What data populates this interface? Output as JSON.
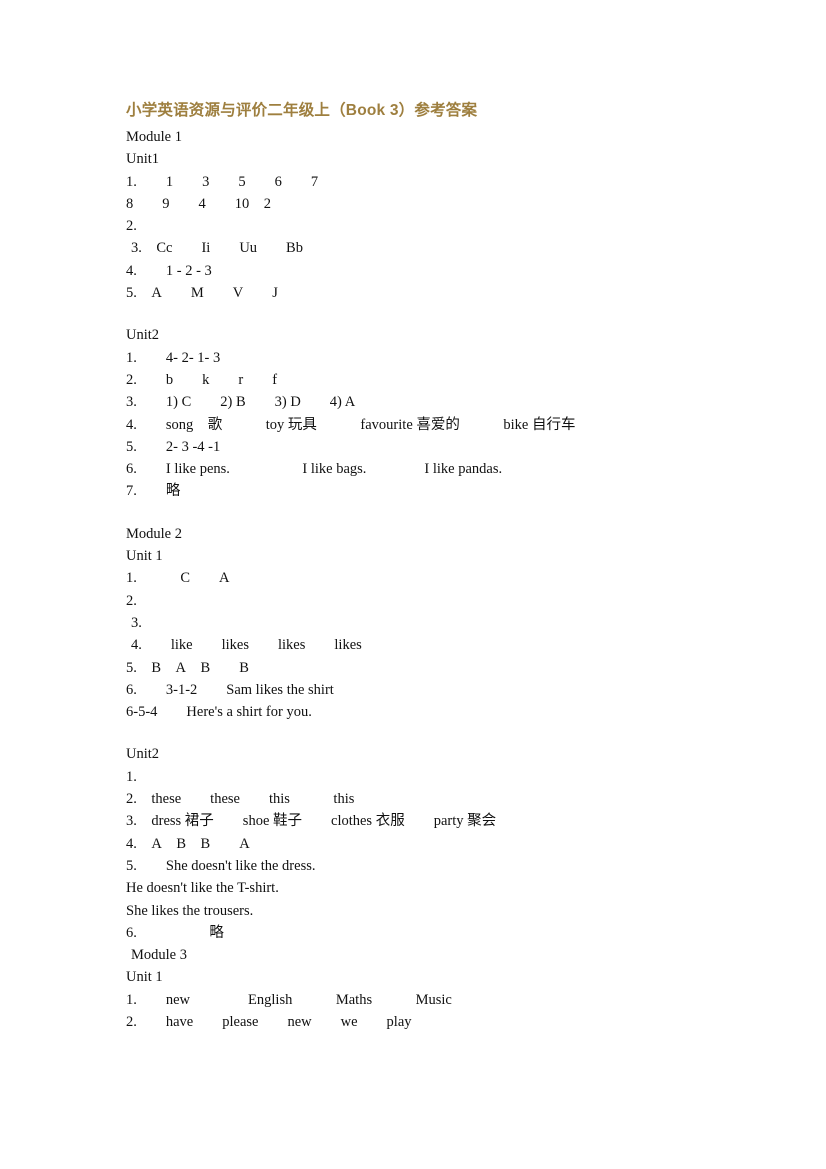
{
  "document": {
    "title": "小学英语资源与评价二年级上（Book 3）参考答案",
    "title_color": "#9e7f3f",
    "page_background": "#ffffff",
    "body_text_color": "#111111"
  },
  "blocks": [
    {
      "kind": "module-heading",
      "text": "Module 1",
      "indent": 0
    },
    {
      "kind": "unit-heading",
      "text": "Unit1",
      "indent": 0
    },
    {
      "kind": "answer-line",
      "text": "1.  1  3  5  6  7",
      "indent": 0
    },
    {
      "kind": "answer-line",
      "text": "8  9  4  10 2",
      "indent": 0
    },
    {
      "kind": "answer-line",
      "text": "2.",
      "indent": 0
    },
    {
      "kind": "answer-line",
      "text": "3. Cc  Ii  Uu  Bb",
      "indent": 5
    },
    {
      "kind": "answer-line",
      "text": "4.  1 - 2 - 3",
      "indent": 0
    },
    {
      "kind": "answer-line",
      "text": "5. A  M  V  J",
      "indent": 0
    },
    {
      "kind": "spacer",
      "size": "md"
    },
    {
      "kind": "unit-heading",
      "text": "Unit2",
      "indent": 0
    },
    {
      "kind": "answer-line",
      "text": "1.  4- 2- 1- 3",
      "indent": 0
    },
    {
      "kind": "answer-line",
      "text": "2.  b  k  r  f",
      "indent": 0
    },
    {
      "kind": "answer-line",
      "text": "3.  1) C  2) B  3) D  4) A",
      "indent": 0
    },
    {
      "kind": "answer-line",
      "text": "4.  song 歌   toy 玩具   favourite 喜爱的   bike 自行车",
      "indent": 0
    },
    {
      "kind": "answer-line",
      "text": "5.  2- 3 -4 -1",
      "indent": 0
    },
    {
      "kind": "answer-line",
      "text": "6.  I like pens.     I like bags.    I like pandas.",
      "indent": 0
    },
    {
      "kind": "answer-line",
      "text": "7.  略",
      "indent": 0
    },
    {
      "kind": "spacer",
      "size": "md"
    },
    {
      "kind": "module-heading",
      "text": "Module 2",
      "indent": 0
    },
    {
      "kind": "unit-heading",
      "text": "Unit 1",
      "indent": 0
    },
    {
      "kind": "answer-line",
      "text": "1.   C  A",
      "indent": 0
    },
    {
      "kind": "answer-line",
      "text": "2.",
      "indent": 0
    },
    {
      "kind": "answer-line",
      "text": "3.",
      "indent": 5
    },
    {
      "kind": "answer-line",
      "text": "4.  like  likes  likes  likes",
      "indent": 5
    },
    {
      "kind": "answer-line",
      "text": "5. B A B  B",
      "indent": 0
    },
    {
      "kind": "answer-line",
      "text": "6.  3-1-2  Sam likes the shirt",
      "indent": 0
    },
    {
      "kind": "answer-line",
      "text": "6-5-4  Here's a shirt for you.",
      "indent": 0
    },
    {
      "kind": "spacer",
      "size": "md"
    },
    {
      "kind": "unit-heading",
      "text": "Unit2",
      "indent": 0
    },
    {
      "kind": "answer-line",
      "text": "1.",
      "indent": 0
    },
    {
      "kind": "answer-line",
      "text": "2. these  these  this   this",
      "indent": 0
    },
    {
      "kind": "answer-line",
      "text": "3. dress 裙子  shoe 鞋子  clothes 衣服  party 聚会",
      "indent": 0
    },
    {
      "kind": "answer-line",
      "text": "4. A B B  A",
      "indent": 0
    },
    {
      "kind": "answer-line",
      "text": "5.  She doesn't like the dress.",
      "indent": 0
    },
    {
      "kind": "answer-line",
      "text": "He doesn't like the T-shirt.",
      "indent": 0
    },
    {
      "kind": "answer-line",
      "text": "She likes the trousers.",
      "indent": 0
    },
    {
      "kind": "answer-line",
      "text": "6.     略",
      "indent": 0
    },
    {
      "kind": "module-heading",
      "text": "Module 3",
      "indent": 5
    },
    {
      "kind": "unit-heading",
      "text": "Unit 1",
      "indent": 0
    },
    {
      "kind": "answer-line",
      "text": "1.  new    English   Maths   Music",
      "indent": 0
    },
    {
      "kind": "answer-line",
      "text": "2.  have  please  new  we  play",
      "indent": 0
    }
  ]
}
